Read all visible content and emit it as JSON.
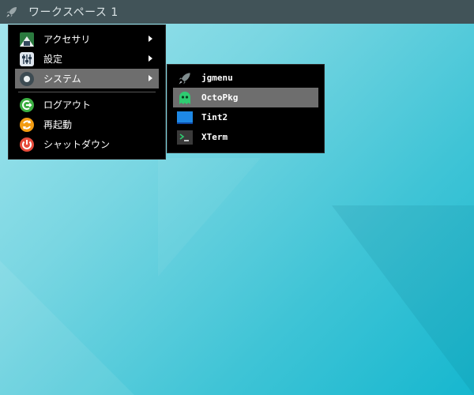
{
  "taskbar": {
    "workspace_label": "ワークスペース 1",
    "icon": "rocket-icon"
  },
  "main_menu": {
    "items": [
      {
        "label": "アクセサリ",
        "icon": "accessories-icon",
        "has_submenu": true
      },
      {
        "label": "設定",
        "icon": "settings-icon",
        "has_submenu": true
      },
      {
        "label": "システム",
        "icon": "system-icon",
        "has_submenu": true,
        "active": true
      },
      {
        "label": "ログアウト",
        "icon": "logout-icon",
        "has_submenu": false
      },
      {
        "label": "再起動",
        "icon": "reboot-icon",
        "has_submenu": false
      },
      {
        "label": "シャットダウン",
        "icon": "shutdown-icon",
        "has_submenu": false
      }
    ]
  },
  "system_submenu": {
    "items": [
      {
        "label": "jgmenu",
        "icon": "rocket-icon"
      },
      {
        "label": "OctoPkg",
        "icon": "octopkg-icon",
        "active": true
      },
      {
        "label": "Tint2",
        "icon": "tint2-icon"
      },
      {
        "label": "XTerm",
        "icon": "terminal-icon"
      }
    ]
  },
  "colors": {
    "taskbar": "#415358",
    "menu_bg": "#000000",
    "highlight": "#6e6e6e",
    "logout": "#3cb043",
    "reboot": "#f39c12",
    "shutdown": "#e74c3c",
    "octopkg": "#2ecc71",
    "tint2": "#1e88e5"
  }
}
